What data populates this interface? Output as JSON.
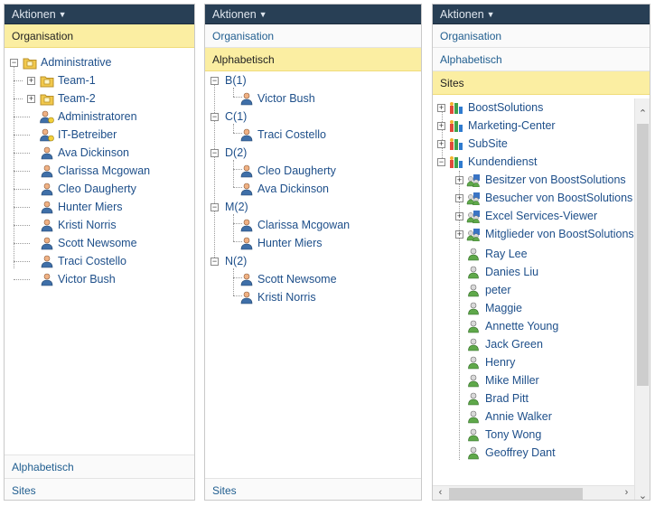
{
  "actions_label": "Aktionen",
  "panel1": {
    "header_top": "Organisation",
    "header_bottom1": "Alphabetisch",
    "header_bottom2": "Sites",
    "root": "Administrative",
    "items": [
      "Team-1",
      "Team-2",
      "Administratoren",
      "IT-Betreiber",
      "Ava Dickinson",
      "Clarissa Mcgowan",
      "Cleo Daugherty",
      "Hunter Miers",
      "Kristi Norris",
      "Scott Newsome",
      "Traci Costello",
      "Victor Bush"
    ]
  },
  "panel2": {
    "header_top": "Organisation",
    "header_active": "Alphabetisch",
    "header_bottom": "Sites",
    "groups": [
      {
        "label": "B(1)",
        "members": [
          "Victor Bush"
        ]
      },
      {
        "label": "C(1)",
        "members": [
          "Traci Costello"
        ]
      },
      {
        "label": "D(2)",
        "members": [
          "Cleo Daugherty",
          "Ava Dickinson"
        ]
      },
      {
        "label": "M(2)",
        "members": [
          "Clarissa Mcgowan",
          "Hunter Miers"
        ]
      },
      {
        "label": "N(2)",
        "members": [
          "Scott Newsome",
          "Kristi Norris"
        ]
      }
    ]
  },
  "panel3": {
    "header_top": "Organisation",
    "header_mid": "Alphabetisch",
    "header_active": "Sites",
    "sites": [
      "BoostSolutions",
      "Marketing-Center",
      "SubSite",
      "Kundendienst"
    ],
    "groups": [
      "Besitzer von BoostSolutions",
      "Besucher von BoostSolutions",
      "Excel Services-Viewer",
      "Mitglieder von BoostSolutions"
    ],
    "users": [
      "Ray Lee",
      "Danies Liu",
      "peter",
      "Maggie",
      "Annette Young",
      "Jack Green",
      "Henry",
      "Mike Miller",
      "Brad Pitt",
      "Annie Walker",
      "Tony Wong",
      "Geoffrey Dant"
    ]
  },
  "icons": {
    "folder": "folder-icon",
    "person": "person-icon",
    "group": "group-icon",
    "site": "site-icon"
  }
}
